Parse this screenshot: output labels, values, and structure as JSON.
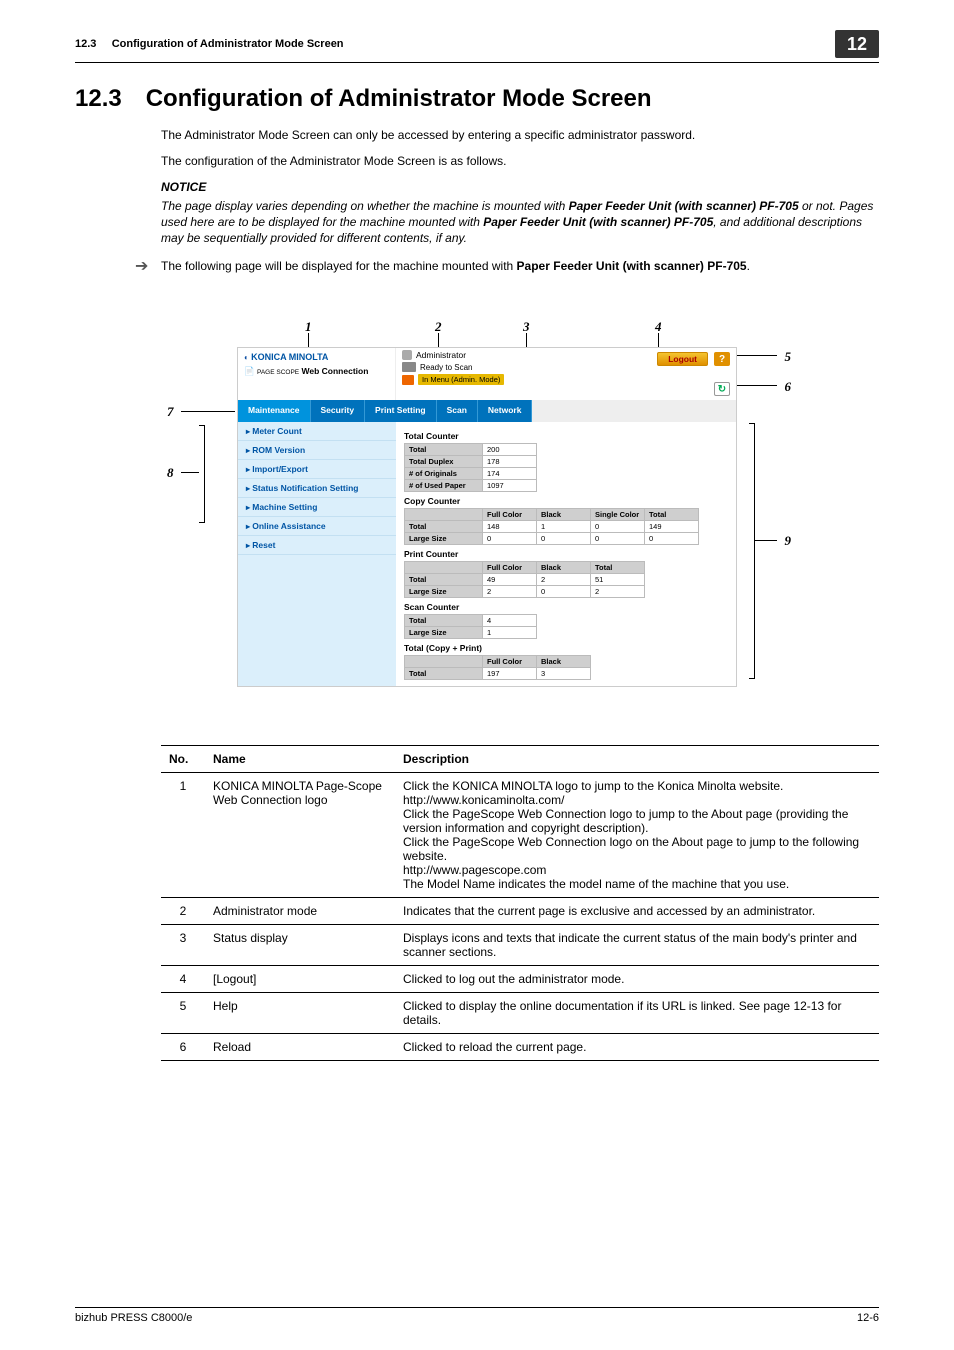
{
  "header": {
    "section_code": "12.3",
    "section_line": "Configuration of Administrator Mode Screen",
    "chapter_box": "12"
  },
  "heading": {
    "num": "12.3",
    "title": "Configuration of Administrator Mode Screen"
  },
  "intro": {
    "p1": "The Administrator Mode Screen can only be accessed by entering a specific administrator password.",
    "p2": "The configuration of the Administrator Mode Screen is as follows.",
    "notice_label": "NOTICE",
    "notice_pre": "The page display varies depending on whether the machine is mounted with ",
    "notice_bold1": "Paper Feeder Unit (with scanner) PF-705",
    "notice_mid": " or not. Pages used here are to be displayed for the machine mounted with ",
    "notice_bold2": "Paper Feeder Unit (with scanner) PF-705",
    "notice_post": ", and additional descriptions may be sequentially provided for different contents, if any.",
    "arrow_pre": "The following page will be displayed for the machine mounted with ",
    "arrow_bold": "Paper Feeder Unit (with scanner) PF-705",
    "arrow_post": "."
  },
  "figure": {
    "callouts": {
      "c1": "1",
      "c2": "2",
      "c3": "3",
      "c4": "4",
      "c5": "5",
      "c6": "6",
      "c7": "7",
      "c8": "8",
      "c9": "9"
    },
    "logo_brand": "KONICA MINOLTA",
    "pswc_label": "Web Connection",
    "pswc_prefix": "PAGE SCOPE",
    "admin_label": "Administrator",
    "ready": "Ready to Scan",
    "inmenu": "In Menu (Admin. Mode)",
    "logout": "Logout",
    "help_glyph": "?",
    "reload_glyph": "↻",
    "tabs": [
      "Maintenance",
      "Security",
      "Print Setting",
      "Scan",
      "Network"
    ],
    "side_items": [
      "Meter Count",
      "ROM Version",
      "Import/Export",
      "Status Notification Setting",
      "Machine Setting",
      "Online Assistance",
      "Reset"
    ],
    "total_counter": {
      "title": "Total Counter",
      "rows": [
        {
          "l": "Total",
          "v": "200"
        },
        {
          "l": "Total Duplex",
          "v": "178"
        },
        {
          "l": "# of Originals",
          "v": "174"
        },
        {
          "l": "# of Used Paper",
          "v": "1097"
        }
      ]
    },
    "copy_counter": {
      "title": "Copy Counter",
      "headers": [
        "",
        "Full Color",
        "Black",
        "Single Color",
        "Total"
      ],
      "rows": [
        [
          "Total",
          "148",
          "1",
          "0",
          "149"
        ],
        [
          "Large Size",
          "0",
          "0",
          "0",
          "0"
        ]
      ]
    },
    "print_counter": {
      "title": "Print Counter",
      "headers": [
        "",
        "Full Color",
        "Black",
        "Total"
      ],
      "rows": [
        [
          "Total",
          "49",
          "2",
          "51"
        ],
        [
          "Large Size",
          "2",
          "0",
          "2"
        ]
      ]
    },
    "scan_counter": {
      "title": "Scan Counter",
      "rows": [
        {
          "l": "Total",
          "v": "4"
        },
        {
          "l": "Large Size",
          "v": "1"
        }
      ]
    },
    "total_cp": {
      "title": "Total (Copy + Print)",
      "headers": [
        "",
        "Full Color",
        "Black"
      ],
      "rows": [
        [
          "Total",
          "197",
          "3"
        ]
      ]
    }
  },
  "table": {
    "headers": {
      "no": "No.",
      "name": "Name",
      "desc": "Description"
    },
    "rows": [
      {
        "no": "1",
        "name": "KONICA MINOLTA Page-Scope Web Connection logo",
        "desc": "Click the KONICA MINOLTA logo to jump to the Konica Minolta website.\nhttp://www.konicaminolta.com/\nClick the PageScope Web Connection logo to jump to the About page (providing the version information and copyright description).\nClick the PageScope Web Connection logo on the About page to jump to the following website.\nhttp://www.pagescope.com\nThe Model Name indicates the model name of the machine that you use."
      },
      {
        "no": "2",
        "name": "Administrator mode",
        "desc": "Indicates that the current page is exclusive and accessed by an administrator."
      },
      {
        "no": "3",
        "name": "Status display",
        "desc": "Displays icons and texts that indicate the current status of the main body's printer and scanner sections."
      },
      {
        "no": "4",
        "name": "[Logout]",
        "desc": "Clicked to log out the administrator mode."
      },
      {
        "no": "5",
        "name": "Help",
        "desc": "Clicked to display the online documentation if its URL is linked. See page 12-13 for details."
      },
      {
        "no": "6",
        "name": "Reload",
        "desc": "Clicked to reload the current page."
      }
    ]
  },
  "footer": {
    "left": "bizhub PRESS C8000/e",
    "right": "12-6"
  }
}
